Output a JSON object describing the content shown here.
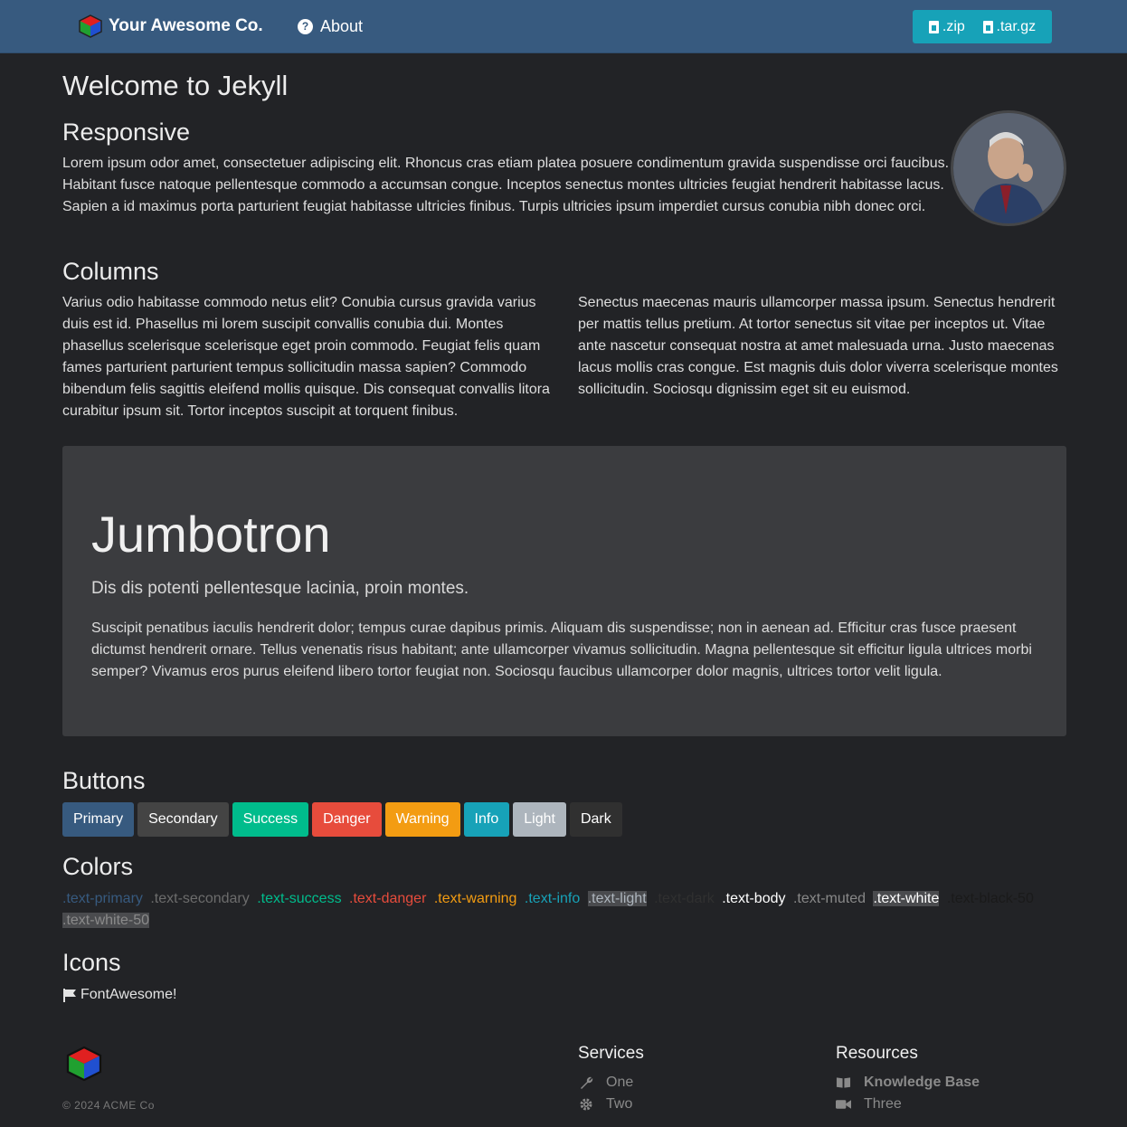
{
  "nav": {
    "brand": "Your Awesome Co.",
    "about": "About",
    "zip": ".zip",
    "targz": ".tar.gz"
  },
  "page": {
    "title": "Welcome to Jekyll",
    "responsive_heading": "Responsive",
    "responsive_text": "Lorem ipsum odor amet, consectetuer adipiscing elit. Rhoncus cras etiam platea posuere condimentum gravida suspendisse orci faucibus. Habitant fusce natoque pellentesque commodo a accumsan congue. Inceptos senectus montes ultricies feugiat hendrerit habitasse lacus. Sapien a id maximus porta parturient feugiat habitasse ultricies finibus. Turpis ultricies ipsum imperdiet cursus conubia nibh donec orci.",
    "columns_heading": "Columns",
    "col1": "Varius odio habitasse commodo netus elit? Conubia cursus gravida varius duis est id. Phasellus mi lorem suscipit convallis conubia dui. Montes phasellus scelerisque scelerisque eget proin commodo. Feugiat felis quam fames parturient parturient tempus sollicitudin massa sapien? Commodo bibendum felis sagittis eleifend mollis quisque. Dis consequat convallis litora curabitur ipsum sit. Tortor inceptos suscipit at torquent finibus.",
    "col2": "Senectus maecenas mauris ullamcorper massa ipsum. Senectus hendrerit per mattis tellus pretium. At tortor senectus sit vitae per inceptos ut. Vitae ante nascetur consequat nostra at amet malesuada urna. Justo maecenas lacus mollis cras congue. Est magnis duis dolor viverra scelerisque montes sollicitudin. Sociosqu dignissim eget sit eu euismod."
  },
  "jumbotron": {
    "title": "Jumbotron",
    "lead": "Dis dis potenti pellentesque lacinia, proin montes.",
    "text": "Suscipit penatibus iaculis hendrerit dolor; tempus curae dapibus primis. Aliquam dis suspendisse; non in aenean ad. Efficitur cras fusce praesent dictumst hendrerit ornare. Tellus venenatis risus habitant; ante ullamcorper vivamus sollicitudin. Magna pellentesque sit efficitur ligula ultrices morbi semper? Vivamus eros purus eleifend libero tortor feugiat non. Sociosqu faucibus ullamcorper dolor magnis, ultrices tortor velit ligula."
  },
  "buttons": {
    "heading": "Buttons",
    "items": [
      {
        "label": "Primary",
        "color": "#375a7f"
      },
      {
        "label": "Secondary",
        "color": "#444444"
      },
      {
        "label": "Success",
        "color": "#00bc8c"
      },
      {
        "label": "Danger",
        "color": "#e74c3c"
      },
      {
        "label": "Warning",
        "color": "#f39c12"
      },
      {
        "label": "Info",
        "color": "#17a2b8"
      },
      {
        "label": "Light",
        "color": "#adb5bd"
      },
      {
        "label": "Dark",
        "color": "#303030"
      }
    ]
  },
  "colors": {
    "heading": "Colors",
    "items": [
      {
        "label": ".text-primary",
        "color": "#375a7f"
      },
      {
        "label": ".text-secondary",
        "color": "#6c6c6c"
      },
      {
        "label": ".text-success",
        "color": "#00bc8c"
      },
      {
        "label": ".text-danger",
        "color": "#e74c3c"
      },
      {
        "label": ".text-warning",
        "color": "#f39c12"
      },
      {
        "label": ".text-info",
        "color": "#17a2b8"
      },
      {
        "label": ".text-light",
        "color": "#adb5bd"
      },
      {
        "label": ".text-dark",
        "color": "#303030"
      },
      {
        "label": ".text-body",
        "color": "#ffffff"
      },
      {
        "label": ".text-muted",
        "color": "#888888"
      },
      {
        "label": ".text-white",
        "color": "#ffffff"
      },
      {
        "label": ".text-black-50",
        "color": "#1a1a1a"
      },
      {
        "label": ".text-white-50",
        "color": "#8a8a8a"
      }
    ]
  },
  "icons": {
    "heading": "Icons",
    "label": "FontAwesome!"
  },
  "footer": {
    "copyright": "© 2024 ACME Co",
    "services_heading": "Services",
    "services": [
      {
        "label": "One",
        "icon": "wrench-icon"
      },
      {
        "label": "Two",
        "icon": "gear-icon"
      }
    ],
    "resources_heading": "Resources",
    "resources": [
      {
        "label": "Knowledge Base",
        "icon": "book-icon"
      },
      {
        "label": "Three",
        "icon": "video-icon"
      }
    ]
  }
}
